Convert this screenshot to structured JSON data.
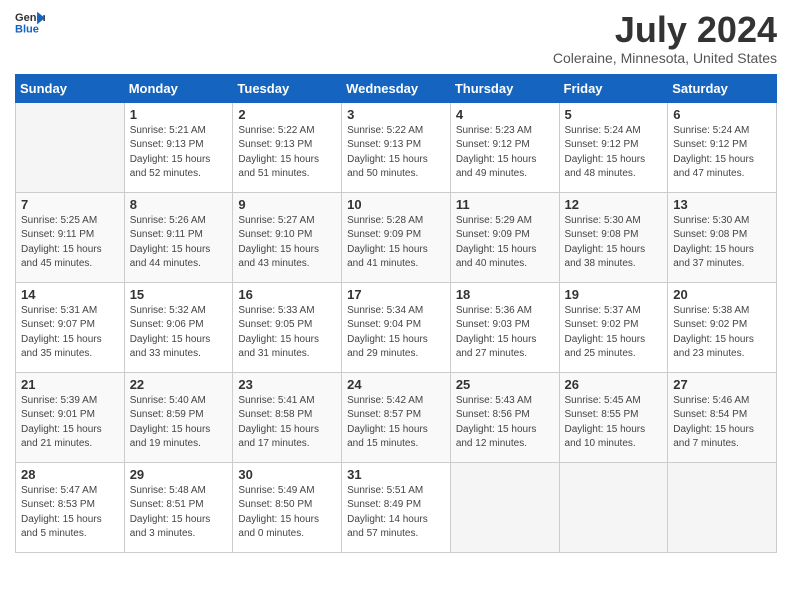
{
  "header": {
    "logo_general": "General",
    "logo_blue": "Blue",
    "month_year": "July 2024",
    "location": "Coleraine, Minnesota, United States"
  },
  "days_of_week": [
    "Sunday",
    "Monday",
    "Tuesday",
    "Wednesday",
    "Thursday",
    "Friday",
    "Saturday"
  ],
  "weeks": [
    [
      {
        "day": "",
        "info": ""
      },
      {
        "day": "1",
        "info": "Sunrise: 5:21 AM\nSunset: 9:13 PM\nDaylight: 15 hours\nand 52 minutes."
      },
      {
        "day": "2",
        "info": "Sunrise: 5:22 AM\nSunset: 9:13 PM\nDaylight: 15 hours\nand 51 minutes."
      },
      {
        "day": "3",
        "info": "Sunrise: 5:22 AM\nSunset: 9:13 PM\nDaylight: 15 hours\nand 50 minutes."
      },
      {
        "day": "4",
        "info": "Sunrise: 5:23 AM\nSunset: 9:12 PM\nDaylight: 15 hours\nand 49 minutes."
      },
      {
        "day": "5",
        "info": "Sunrise: 5:24 AM\nSunset: 9:12 PM\nDaylight: 15 hours\nand 48 minutes."
      },
      {
        "day": "6",
        "info": "Sunrise: 5:24 AM\nSunset: 9:12 PM\nDaylight: 15 hours\nand 47 minutes."
      }
    ],
    [
      {
        "day": "7",
        "info": "Sunrise: 5:25 AM\nSunset: 9:11 PM\nDaylight: 15 hours\nand 45 minutes."
      },
      {
        "day": "8",
        "info": "Sunrise: 5:26 AM\nSunset: 9:11 PM\nDaylight: 15 hours\nand 44 minutes."
      },
      {
        "day": "9",
        "info": "Sunrise: 5:27 AM\nSunset: 9:10 PM\nDaylight: 15 hours\nand 43 minutes."
      },
      {
        "day": "10",
        "info": "Sunrise: 5:28 AM\nSunset: 9:09 PM\nDaylight: 15 hours\nand 41 minutes."
      },
      {
        "day": "11",
        "info": "Sunrise: 5:29 AM\nSunset: 9:09 PM\nDaylight: 15 hours\nand 40 minutes."
      },
      {
        "day": "12",
        "info": "Sunrise: 5:30 AM\nSunset: 9:08 PM\nDaylight: 15 hours\nand 38 minutes."
      },
      {
        "day": "13",
        "info": "Sunrise: 5:30 AM\nSunset: 9:08 PM\nDaylight: 15 hours\nand 37 minutes."
      }
    ],
    [
      {
        "day": "14",
        "info": "Sunrise: 5:31 AM\nSunset: 9:07 PM\nDaylight: 15 hours\nand 35 minutes."
      },
      {
        "day": "15",
        "info": "Sunrise: 5:32 AM\nSunset: 9:06 PM\nDaylight: 15 hours\nand 33 minutes."
      },
      {
        "day": "16",
        "info": "Sunrise: 5:33 AM\nSunset: 9:05 PM\nDaylight: 15 hours\nand 31 minutes."
      },
      {
        "day": "17",
        "info": "Sunrise: 5:34 AM\nSunset: 9:04 PM\nDaylight: 15 hours\nand 29 minutes."
      },
      {
        "day": "18",
        "info": "Sunrise: 5:36 AM\nSunset: 9:03 PM\nDaylight: 15 hours\nand 27 minutes."
      },
      {
        "day": "19",
        "info": "Sunrise: 5:37 AM\nSunset: 9:02 PM\nDaylight: 15 hours\nand 25 minutes."
      },
      {
        "day": "20",
        "info": "Sunrise: 5:38 AM\nSunset: 9:02 PM\nDaylight: 15 hours\nand 23 minutes."
      }
    ],
    [
      {
        "day": "21",
        "info": "Sunrise: 5:39 AM\nSunset: 9:01 PM\nDaylight: 15 hours\nand 21 minutes."
      },
      {
        "day": "22",
        "info": "Sunrise: 5:40 AM\nSunset: 8:59 PM\nDaylight: 15 hours\nand 19 minutes."
      },
      {
        "day": "23",
        "info": "Sunrise: 5:41 AM\nSunset: 8:58 PM\nDaylight: 15 hours\nand 17 minutes."
      },
      {
        "day": "24",
        "info": "Sunrise: 5:42 AM\nSunset: 8:57 PM\nDaylight: 15 hours\nand 15 minutes."
      },
      {
        "day": "25",
        "info": "Sunrise: 5:43 AM\nSunset: 8:56 PM\nDaylight: 15 hours\nand 12 minutes."
      },
      {
        "day": "26",
        "info": "Sunrise: 5:45 AM\nSunset: 8:55 PM\nDaylight: 15 hours\nand 10 minutes."
      },
      {
        "day": "27",
        "info": "Sunrise: 5:46 AM\nSunset: 8:54 PM\nDaylight: 15 hours\nand 7 minutes."
      }
    ],
    [
      {
        "day": "28",
        "info": "Sunrise: 5:47 AM\nSunset: 8:53 PM\nDaylight: 15 hours\nand 5 minutes."
      },
      {
        "day": "29",
        "info": "Sunrise: 5:48 AM\nSunset: 8:51 PM\nDaylight: 15 hours\nand 3 minutes."
      },
      {
        "day": "30",
        "info": "Sunrise: 5:49 AM\nSunset: 8:50 PM\nDaylight: 15 hours\nand 0 minutes."
      },
      {
        "day": "31",
        "info": "Sunrise: 5:51 AM\nSunset: 8:49 PM\nDaylight: 14 hours\nand 57 minutes."
      },
      {
        "day": "",
        "info": ""
      },
      {
        "day": "",
        "info": ""
      },
      {
        "day": "",
        "info": ""
      }
    ]
  ]
}
